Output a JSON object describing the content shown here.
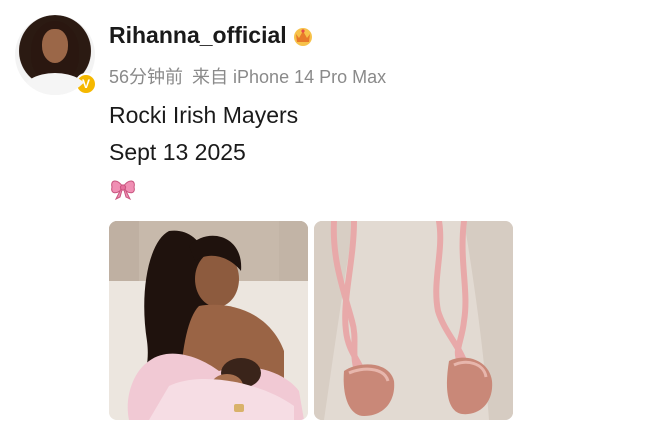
{
  "user": {
    "name": "Rihanna_official",
    "crown_icon": "crown-icon",
    "verified_icon": "verified-badge-icon",
    "verified_glyph": "V"
  },
  "meta": {
    "time": "56分钟前",
    "source": "来自 iPhone 14 Pro Max"
  },
  "post": {
    "line1": "Rocki Irish Mayers",
    "line2": "Sept 13 2025",
    "emoji_icon": "ribbon-bow-icon"
  },
  "photos": [
    {
      "name": "photo-mother-baby"
    },
    {
      "name": "photo-pink-ribbon-shoes"
    }
  ],
  "colors": {
    "verified": "#f5b800",
    "meta_text": "#8a8a8a",
    "ribbon_pink": "#e8a9a9"
  }
}
